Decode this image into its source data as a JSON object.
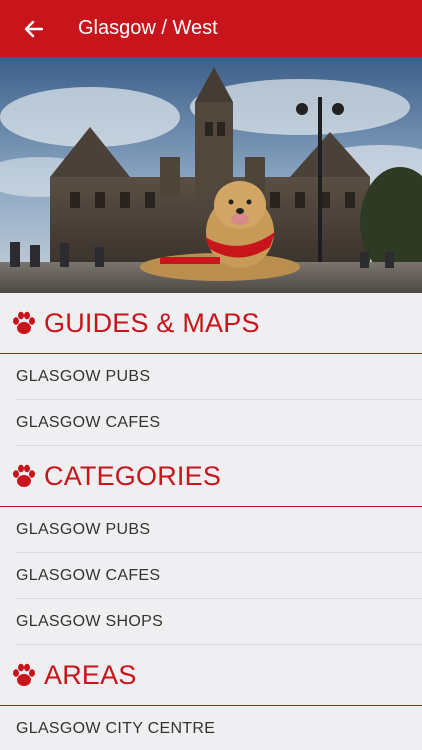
{
  "header": {
    "title": "Glasgow / West"
  },
  "sections": [
    {
      "title": "GUIDES & MAPS",
      "items": [
        "GLASGOW PUBS",
        "GLASGOW CAFES"
      ]
    },
    {
      "title": "CATEGORIES",
      "items": [
        "GLASGOW PUBS",
        "GLASGOW CAFES",
        "GLASGOW SHOPS"
      ]
    },
    {
      "title": "AREAS",
      "items": [
        "GLASGOW CITY CENTRE"
      ]
    }
  ],
  "colors": {
    "accent": "#c8141b",
    "background": "#efeff2"
  },
  "icons": {
    "back": "arrow-left-icon",
    "section": "paw-icon"
  }
}
